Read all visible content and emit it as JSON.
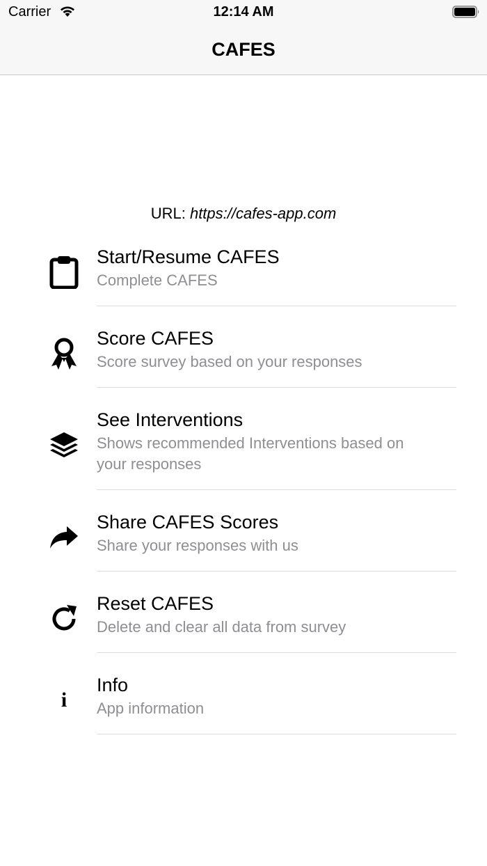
{
  "status_bar": {
    "carrier": "Carrier",
    "time": "12:14 AM",
    "wifi_icon": "wifi-icon",
    "battery_icon": "battery-icon"
  },
  "nav": {
    "title": "CAFES"
  },
  "url": {
    "label": "URL:",
    "value": "https://cafes-app.com"
  },
  "menu": {
    "items": [
      {
        "icon": "clipboard-icon",
        "title": "Start/Resume CAFES",
        "subtitle": "Complete CAFES"
      },
      {
        "icon": "award-ribbon-icon",
        "title": "Score CAFES",
        "subtitle": "Score survey based on your responses"
      },
      {
        "icon": "layers-icon",
        "title": "See Interventions",
        "subtitle": "Shows recommended Interventions based on your responses"
      },
      {
        "icon": "share-arrow-icon",
        "title": "Share CAFES Scores",
        "subtitle": "Share your responses with us"
      },
      {
        "icon": "refresh-icon",
        "title": "Reset CAFES",
        "subtitle": "Delete and clear all data from survey"
      },
      {
        "icon": "info-icon",
        "title": "Info",
        "subtitle": "App information",
        "glyph": "i"
      }
    ]
  },
  "colors": {
    "subtitle": "#8e8e93",
    "separator": "#dcdcdc",
    "bar_background": "#f7f7f7"
  }
}
